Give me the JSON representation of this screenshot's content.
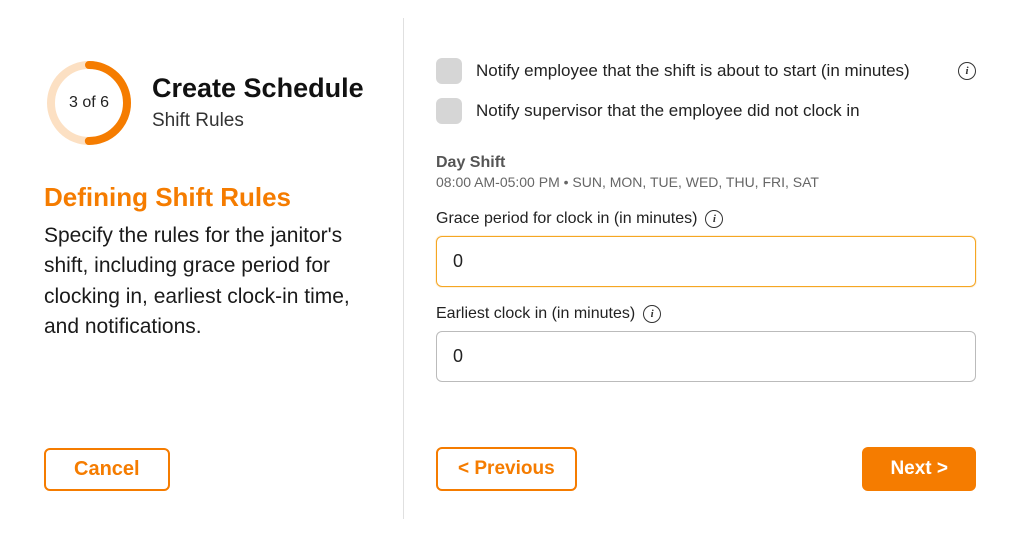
{
  "progress": {
    "step": 3,
    "total": 6,
    "label": "3 of 6"
  },
  "header": {
    "title": "Create Schedule",
    "subtitle": "Shift Rules"
  },
  "section": {
    "heading": "Defining Shift Rules",
    "description": "Specify the rules for the janitor's shift, including grace period for clocking in, earliest clock-in time, and notifications."
  },
  "buttons": {
    "cancel": "Cancel",
    "previous": "< Previous",
    "next": "Next >"
  },
  "notifications": {
    "employee": "Notify employee that the shift is about to start (in minutes)",
    "supervisor": "Notify supervisor that the employee did not clock in"
  },
  "shift": {
    "name": "Day Shift",
    "meta": "08:00 AM-05:00 PM • SUN, MON, TUE, WED, THU, FRI, SAT"
  },
  "fields": {
    "grace": {
      "label": "Grace period for clock in (in minutes)",
      "value": "0"
    },
    "earliest": {
      "label": "Earliest clock in (in minutes)",
      "value": "0"
    }
  },
  "info_glyph": "i"
}
